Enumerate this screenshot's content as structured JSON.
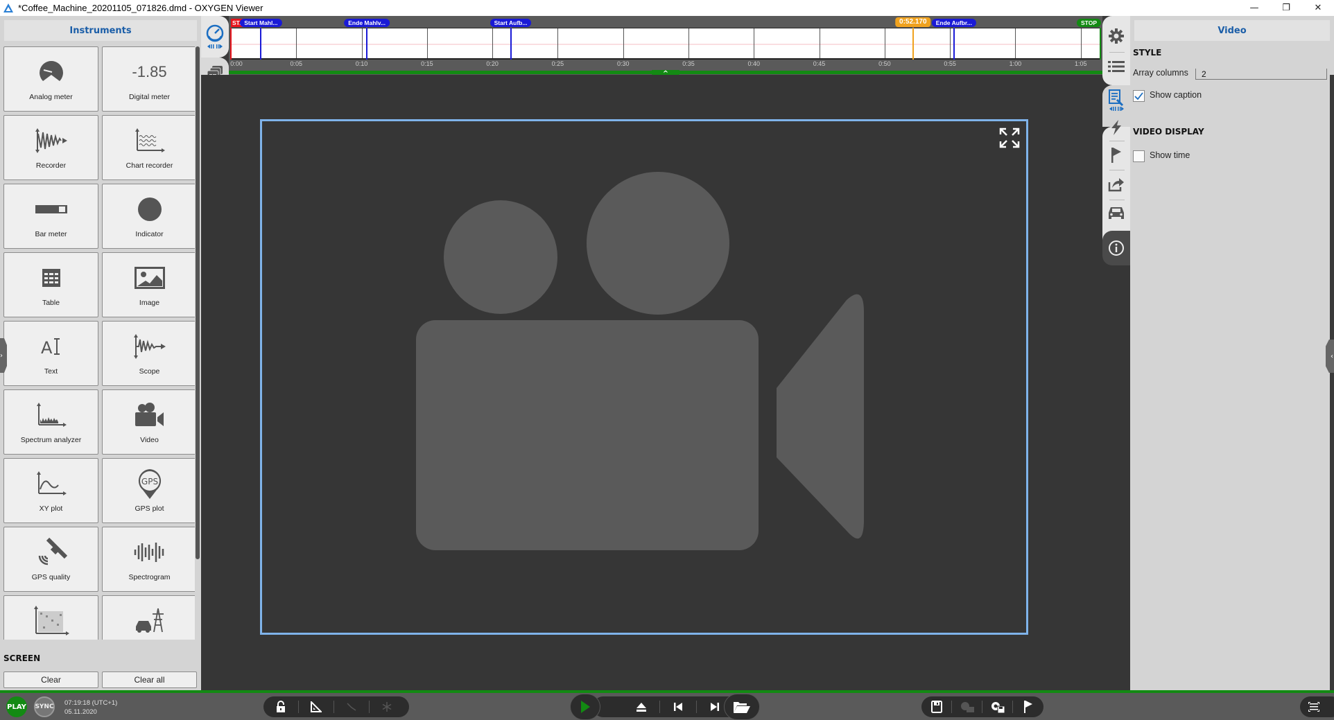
{
  "window": {
    "title": "*Coffee_Machine_20201105_071826.dmd - OXYGEN Viewer",
    "controls": {
      "minimize": "—",
      "restore": "❐",
      "close": "✕"
    }
  },
  "left_panel": {
    "header": "Instruments",
    "instruments": [
      {
        "label": "Analog meter",
        "icon": "analog-meter-icon"
      },
      {
        "label": "Digital meter",
        "icon": "digital-meter-icon",
        "display_value": "-1.85"
      },
      {
        "label": "Recorder",
        "icon": "recorder-icon"
      },
      {
        "label": "Chart recorder",
        "icon": "chart-recorder-icon"
      },
      {
        "label": "Bar meter",
        "icon": "bar-meter-icon"
      },
      {
        "label": "Indicator",
        "icon": "indicator-icon"
      },
      {
        "label": "Table",
        "icon": "table-icon"
      },
      {
        "label": "Image",
        "icon": "image-icon"
      },
      {
        "label": "Text",
        "icon": "text-icon"
      },
      {
        "label": "Scope",
        "icon": "scope-icon"
      },
      {
        "label": "Spectrum analyzer",
        "icon": "spectrum-analyzer-icon"
      },
      {
        "label": "Video",
        "icon": "video-icon"
      },
      {
        "label": "XY plot",
        "icon": "xy-plot-icon"
      },
      {
        "label": "GPS plot",
        "icon": "gps-plot-icon"
      },
      {
        "label": "GPS quality",
        "icon": "gps-quality-icon"
      },
      {
        "label": "Spectrogram",
        "icon": "spectrogram-icon"
      },
      {
        "label": "",
        "icon": "heatmap-plot-icon"
      },
      {
        "label": "",
        "icon": "e-mobility-icon"
      }
    ],
    "screen_section": {
      "title": "SCREEN",
      "clear_label": "Clear",
      "clear_all_label": "Clear all"
    }
  },
  "timeline": {
    "ticks": [
      "0:00",
      "0:05",
      "0:10",
      "0:15",
      "0:20",
      "0:25",
      "0:30",
      "0:35",
      "0:40",
      "0:45",
      "0:50",
      "0:55",
      "1:00",
      "1:05"
    ],
    "markers": [
      {
        "label": "STA",
        "color": "#e8141c",
        "time_s": 0
      },
      {
        "label": "Start Mahl...",
        "color": "#1a1ad6",
        "time_s": 2.3
      },
      {
        "label": "Ende Mahlv...",
        "color": "#1a1ad6",
        "time_s": 10.4
      },
      {
        "label": "Start Aufb...",
        "color": "#1a1ad6",
        "time_s": 21.4
      },
      {
        "label": "0:52.170",
        "color": "#f0a21e",
        "time_s": 52.17
      },
      {
        "label": "Ende Aufbr...",
        "color": "#1a1ad6",
        "time_s": 55.3
      },
      {
        "label": "STOP",
        "color": "#138a13",
        "time_s": 66.5
      }
    ],
    "duration_s": 66.5,
    "cursor": "0:52.170"
  },
  "main": {
    "video_placeholder": "video-camera-placeholder"
  },
  "right_panel": {
    "header": "Video",
    "style_section": "STYLE",
    "array_columns_label": "Array columns",
    "array_columns_value": "2",
    "show_caption_label": "Show caption",
    "show_caption_checked": true,
    "video_display_section": "VIDEO DISPLAY",
    "show_time_label": "Show time",
    "show_time_checked": false
  },
  "right_strip": [
    "gear-icon",
    "list-icon",
    "instrument-settings-icon",
    "lightning-icon",
    "flag-icon",
    "export-icon",
    "car-icon",
    "info-icon"
  ],
  "status": {
    "play_label": "PLAY",
    "sync_label": "SYNC",
    "time": "07:19:18 (UTC+1)",
    "date": "05.11.2020"
  },
  "colors": {
    "accent_blue": "#1b5ea8",
    "green": "#138a13",
    "marker_blue": "#1a1ad6",
    "cursor_orange": "#f0a21e",
    "start_red": "#e8141c",
    "selection_blue": "#7fb3ea"
  }
}
